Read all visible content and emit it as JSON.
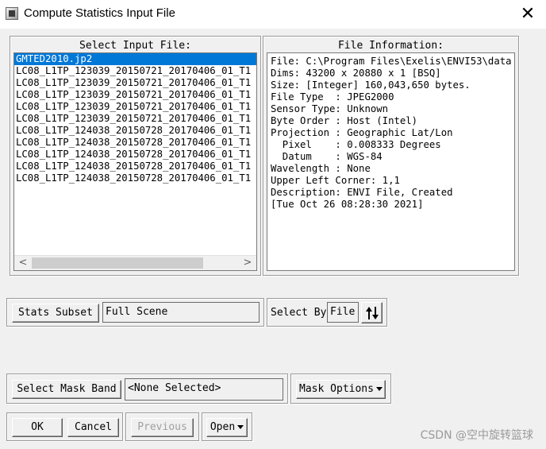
{
  "window": {
    "title": "Compute Statistics Input File",
    "close_glyph": "✕",
    "icon": "envi-app-icon"
  },
  "select_input": {
    "title": "Select Input File:",
    "selected_index": 0,
    "files": [
      "GMTED2010.jp2",
      "LC08_L1TP_123039_20150721_20170406_01_T1",
      "LC08_L1TP_123039_20150721_20170406_01_T1",
      "LC08_L1TP_123039_20150721_20170406_01_T1",
      "LC08_L1TP_123039_20150721_20170406_01_T1",
      "LC08_L1TP_123039_20150721_20170406_01_T1",
      "LC08_L1TP_124038_20150728_20170406_01_T1",
      "LC08_L1TP_124038_20150728_20170406_01_T1",
      "LC08_L1TP_124038_20150728_20170406_01_T1",
      "LC08_L1TP_124038_20150728_20170406_01_T1",
      "LC08_L1TP_124038_20150728_20170406_01_T1"
    ],
    "scroll_left": "<",
    "scroll_right": ">"
  },
  "file_info": {
    "title": "File Information:",
    "lines": [
      "File: C:\\Program Files\\Exelis\\ENVI53\\data",
      "Dims: 43200 x 20880 x 1 [BSQ]",
      "Size: [Integer] 160,043,650 bytes.",
      "File Type  : JPEG2000",
      "Sensor Type: Unknown",
      "Byte Order : Host (Intel)",
      "Projection : Geographic Lat/Lon",
      "  Pixel    : 0.008333 Degrees",
      "  Datum    : WGS-84",
      "Wavelength : None",
      "Upper Left Corner: 1,1",
      "Description: ENVI File, Created",
      "[Tue Oct 26 08:28:30 2021]"
    ]
  },
  "stats_subset": {
    "button": "Stats Subset",
    "value": "Full Scene"
  },
  "select_by": {
    "label": "Select By",
    "value": "File",
    "sort_icon": "sort-arrows-icon"
  },
  "mask": {
    "button": "Select Mask Band",
    "value": "<None Selected>",
    "options_button": "Mask Options"
  },
  "footer": {
    "ok": "OK",
    "cancel": "Cancel",
    "previous": "Previous",
    "open": "Open"
  },
  "watermark": "CSDN @空中旋转篮球"
}
